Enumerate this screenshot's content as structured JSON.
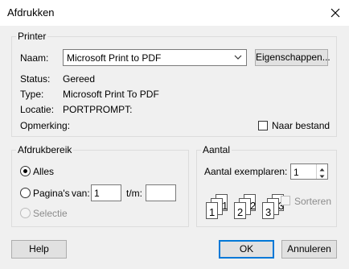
{
  "window": {
    "title": "Afdrukken"
  },
  "printer": {
    "group_label": "Printer",
    "name_label": "Naam:",
    "name_value": "Microsoft Print to PDF",
    "properties_button": "Eigenschappen...",
    "status_label": "Status:",
    "status_value": "Gereed",
    "type_label": "Type:",
    "type_value": "Microsoft Print To PDF",
    "location_label": "Locatie:",
    "location_value": "PORTPROMPT:",
    "comment_label": "Opmerking:",
    "print_to_file_label": "Naar bestand"
  },
  "range": {
    "group_label": "Afdrukbereik",
    "all_label": "Alles",
    "pages_label": "Pagina's",
    "from_label": "van:",
    "from_value": "1",
    "to_label": "t/m:",
    "to_value": "",
    "selection_label": "Selectie"
  },
  "copies": {
    "group_label": "Aantal",
    "count_label": "Aantal exemplaren:",
    "count_value": "1",
    "collate_label": "Sorteren",
    "collate_digits": [
      "1",
      "1",
      "2",
      "2",
      "3",
      "3"
    ]
  },
  "buttons": {
    "help": "Help",
    "ok": "OK",
    "cancel": "Annuleren"
  },
  "colors": {
    "accent": "#0078d7",
    "disabled": "#8c8c8c"
  }
}
